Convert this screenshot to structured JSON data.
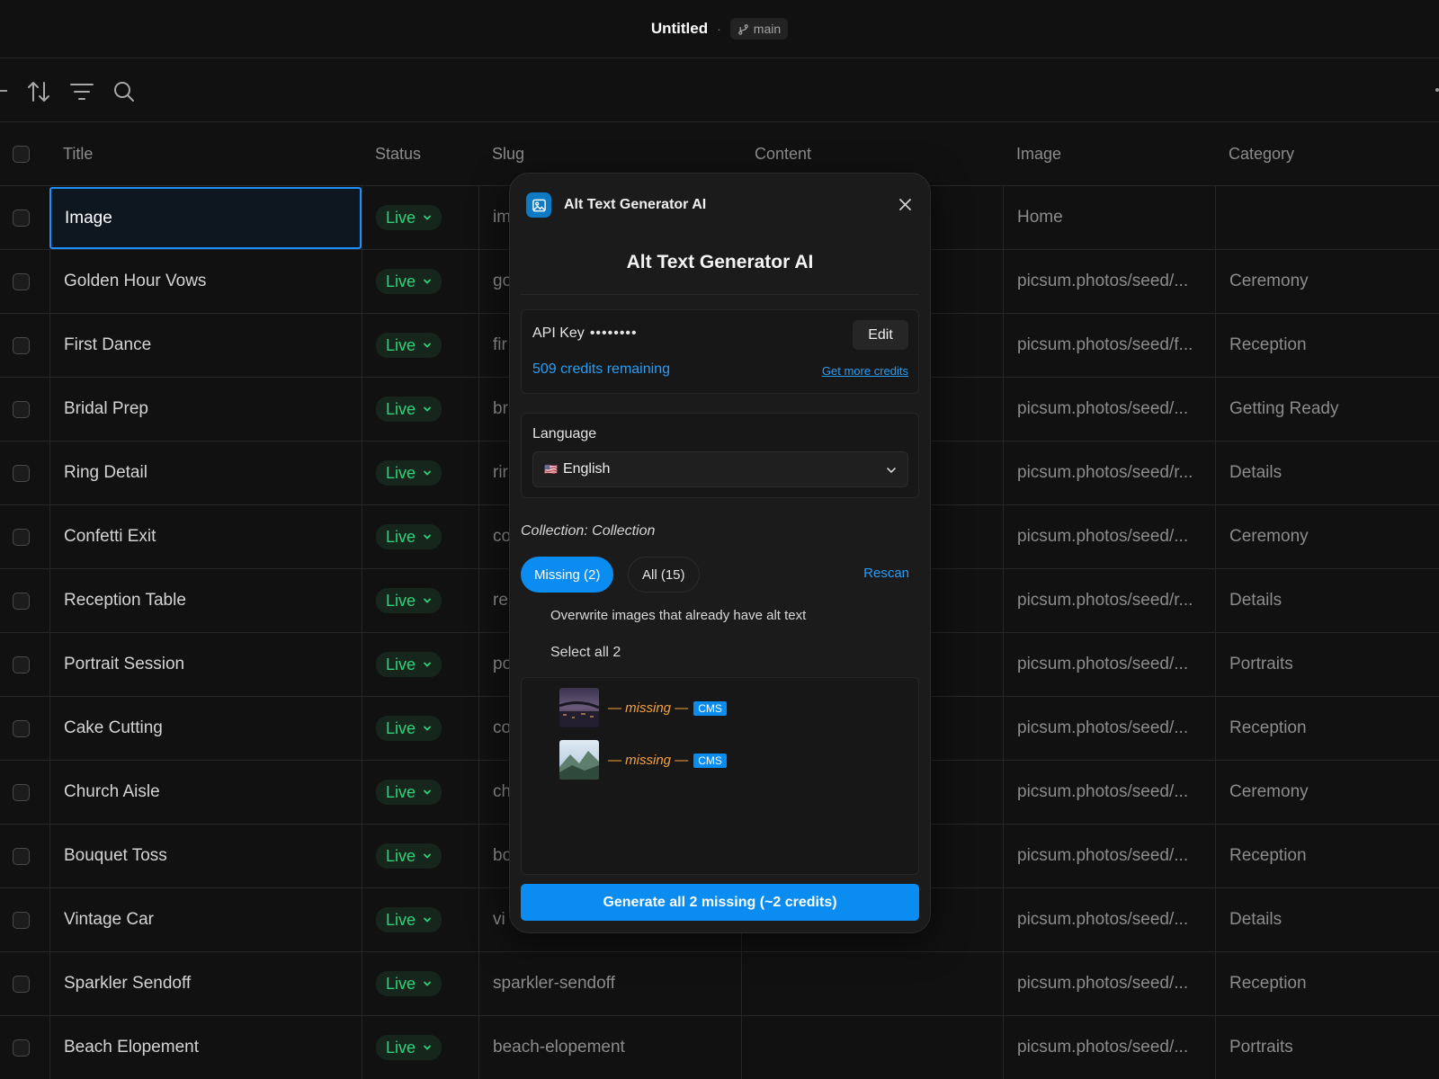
{
  "titlebar": {
    "title": "Untitled",
    "separator": "·",
    "branch": "main"
  },
  "toolbar": {
    "icons": [
      "sort-icon",
      "filter-icon",
      "search-icon"
    ]
  },
  "table": {
    "columns": [
      "Title",
      "Status",
      "Slug",
      "Content",
      "Image",
      "Category"
    ],
    "rows": [
      {
        "title": "Image",
        "status": "Live",
        "slug": "im",
        "content": "",
        "image": "Home",
        "category": ""
      },
      {
        "title": "Golden Hour Vows",
        "status": "Live",
        "slug": "go",
        "content": "",
        "image": "picsum.photos/seed/...",
        "category": "Ceremony"
      },
      {
        "title": "First Dance",
        "status": "Live",
        "slug": "fir",
        "content": "",
        "image": "picsum.photos/seed/f...",
        "category": "Reception"
      },
      {
        "title": "Bridal Prep",
        "status": "Live",
        "slug": "br",
        "content": "",
        "image": "picsum.photos/seed/...",
        "category": "Getting Ready"
      },
      {
        "title": "Ring Detail",
        "status": "Live",
        "slug": "rir",
        "content": "",
        "image": "picsum.photos/seed/r...",
        "category": "Details"
      },
      {
        "title": "Confetti Exit",
        "status": "Live",
        "slug": "co",
        "content": "",
        "image": "picsum.photos/seed/...",
        "category": "Ceremony"
      },
      {
        "title": "Reception Table",
        "status": "Live",
        "slug": "re",
        "content": "",
        "image": "picsum.photos/seed/r...",
        "category": "Details"
      },
      {
        "title": "Portrait Session",
        "status": "Live",
        "slug": "po",
        "content": "",
        "image": "picsum.photos/seed/...",
        "category": "Portraits"
      },
      {
        "title": "Cake Cutting",
        "status": "Live",
        "slug": "co",
        "content": "",
        "image": "picsum.photos/seed/...",
        "category": "Reception"
      },
      {
        "title": "Church Aisle",
        "status": "Live",
        "slug": "ch",
        "content": "",
        "image": "picsum.photos/seed/...",
        "category": "Ceremony"
      },
      {
        "title": "Bouquet Toss",
        "status": "Live",
        "slug": "bo",
        "content": "",
        "image": "picsum.photos/seed/...",
        "category": "Reception"
      },
      {
        "title": "Vintage Car",
        "status": "Live",
        "slug": "vi",
        "content": "",
        "image": "picsum.photos/seed/...",
        "category": "Details"
      },
      {
        "title": "Sparkler Sendoff",
        "status": "Live",
        "slug": "sparkler-sendoff",
        "content": "",
        "image": "picsum.photos/seed/...",
        "category": "Reception"
      },
      {
        "title": "Beach Elopement",
        "status": "Live",
        "slug": "beach-elopement",
        "content": "",
        "image": "picsum.photos/seed/...",
        "category": "Portraits"
      }
    ]
  },
  "panel": {
    "app_name": "Alt Text Generator AI",
    "heading": "Alt Text Generator AI",
    "api_key_label": "API Key",
    "api_key_mask": "••••••••",
    "edit_label": "Edit",
    "credits_text": "509 credits remaining",
    "more_credits": "Get more credits",
    "language_label": "Language",
    "language_flag": "🇺🇸",
    "language_value": "English",
    "collection_label": "Collection: Collection",
    "tab_missing": "Missing (2)",
    "tab_all": "All (15)",
    "rescan": "Rescan",
    "overwrite_label": "Overwrite images that already have alt text",
    "select_all": "Select all 2",
    "images": [
      {
        "alt": "— missing —",
        "source": "CMS"
      },
      {
        "alt": "— missing —",
        "source": "CMS"
      }
    ],
    "generate_button": "Generate all 2 missing (~2 credits)"
  },
  "colors": {
    "accent": "#0a8cf0",
    "live": "#2fd27a",
    "missing": "#f5a13a",
    "selection": "#1e90ff"
  }
}
